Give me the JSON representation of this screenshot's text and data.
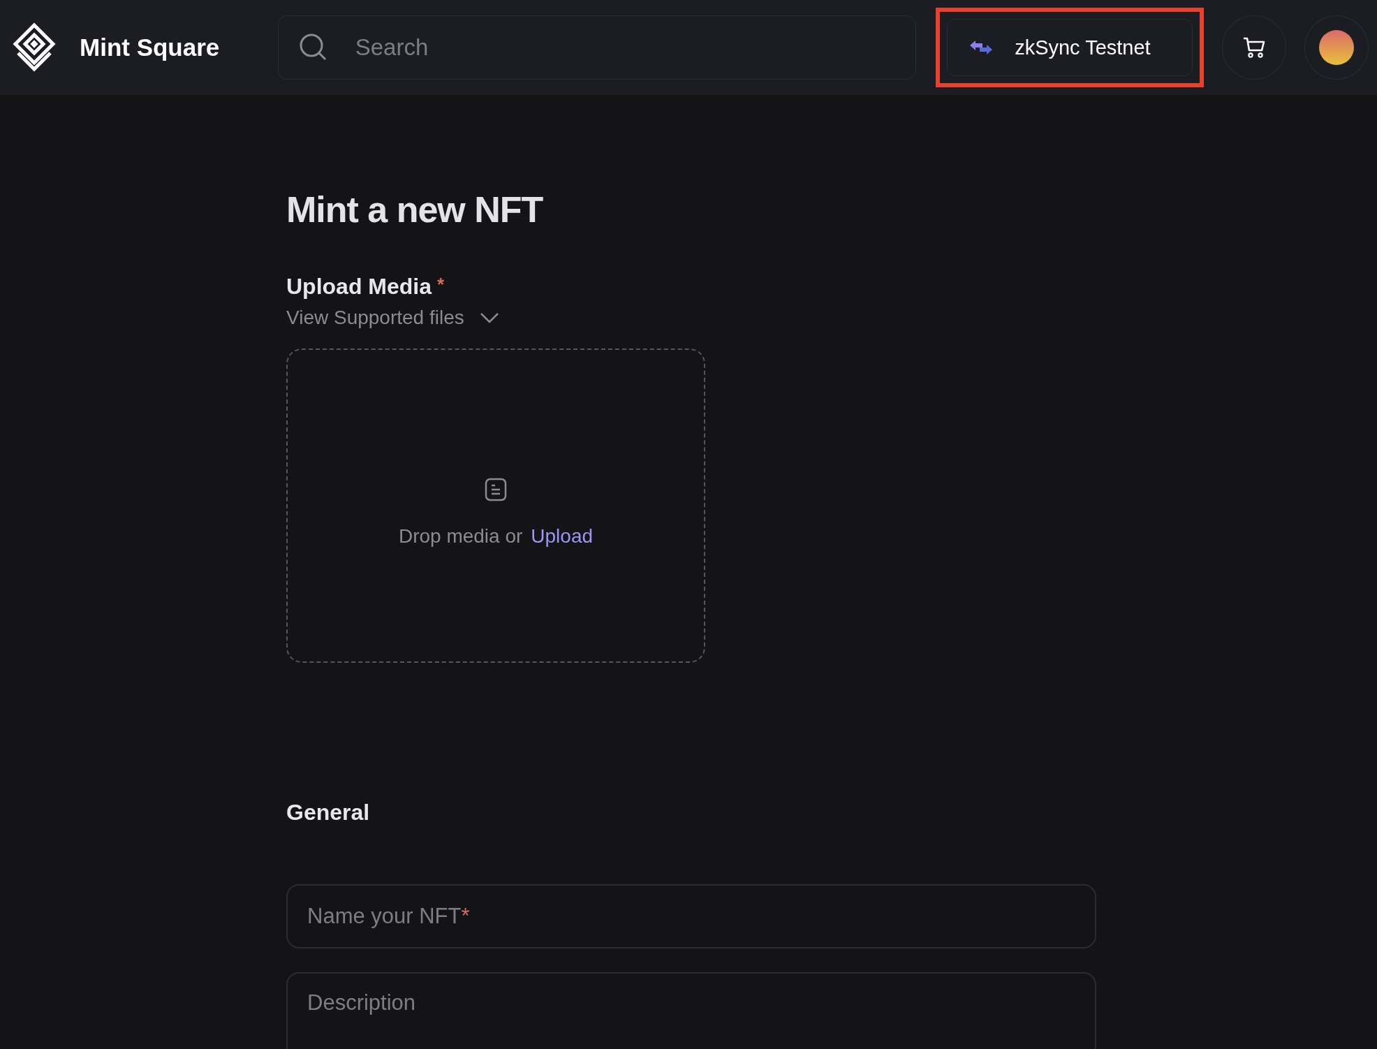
{
  "header": {
    "brand": "Mint Square",
    "search": {
      "placeholder": "Search"
    },
    "network": {
      "label": "zkSync Testnet",
      "highlighted": true
    }
  },
  "page": {
    "title": "Mint a new NFT",
    "upload": {
      "label": "Upload Media",
      "required_mark": "*",
      "supported_toggle": "View Supported files",
      "drop_text": "Drop media or",
      "upload_link": "Upload"
    },
    "general": {
      "heading": "General",
      "fields": [
        {
          "kind": "line",
          "placeholder": "Name your NFT",
          "required_mark": "*"
        },
        {
          "kind": "area",
          "placeholder": "Description"
        }
      ]
    }
  }
}
